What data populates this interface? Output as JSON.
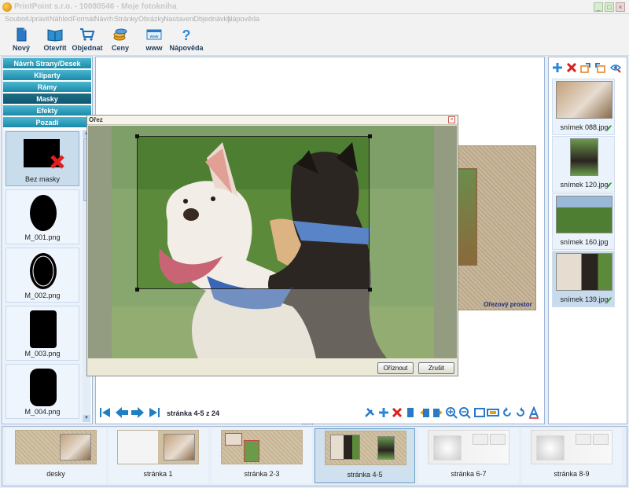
{
  "window": {
    "title": "PrintPoint s.r.o. - 10080546 - Moje fotokniha"
  },
  "menu": {
    "items": [
      "Soubor",
      "Upravit",
      "Náhled",
      "Formát",
      "Návrh",
      "Stránky",
      "Obrázky",
      "Nastavení",
      "Objednávky",
      "Nápověda"
    ]
  },
  "toolbar": {
    "new_label": "Nový",
    "open_label": "Otevřít",
    "order_label": "Objednat",
    "prices_label": "Ceny",
    "www_label": "www",
    "help_label": "Nápověda"
  },
  "left_panel": {
    "categories": [
      {
        "label": "Návrh Strany/Desek"
      },
      {
        "label": "Kliparty"
      },
      {
        "label": "Rámy"
      },
      {
        "label": "Masky"
      },
      {
        "label": "Efekty"
      },
      {
        "label": "Pozadí"
      }
    ],
    "masks": [
      {
        "label": "Bez masky"
      },
      {
        "label": "M_001.png"
      },
      {
        "label": "M_002.png"
      },
      {
        "label": "M_003.png"
      },
      {
        "label": "M_004.png"
      }
    ]
  },
  "center": {
    "page_label": "Ořezový prostor",
    "page_info": "stránka 4-5 z 24"
  },
  "dialog": {
    "title": "Ořez",
    "crop_button": "Oříznout",
    "cancel_button": "Zrušit"
  },
  "right_panel": {
    "thumbnails": [
      {
        "label": "snímek 088.jpg",
        "used": true
      },
      {
        "label": "snímek 120.jpg",
        "used": true
      },
      {
        "label": "snímek 160.jpg",
        "used": false
      },
      {
        "label": "snímek 139.jpg",
        "used": true
      }
    ],
    "check_glyph": "✔"
  },
  "bottom_strip": {
    "spreads": [
      {
        "label": "desky"
      },
      {
        "label": "stránka 1"
      },
      {
        "label": "stránka 2-3"
      },
      {
        "label": "stránka 4-5"
      },
      {
        "label": "stránka 6-7"
      },
      {
        "label": "stránka 8-9"
      }
    ]
  },
  "colors": {
    "category_button": "#1b8aa8",
    "category_active": "#0e5870",
    "selection": "#c8dcec",
    "check_green": "#2a9a2a",
    "delete_red": "#d82020"
  }
}
